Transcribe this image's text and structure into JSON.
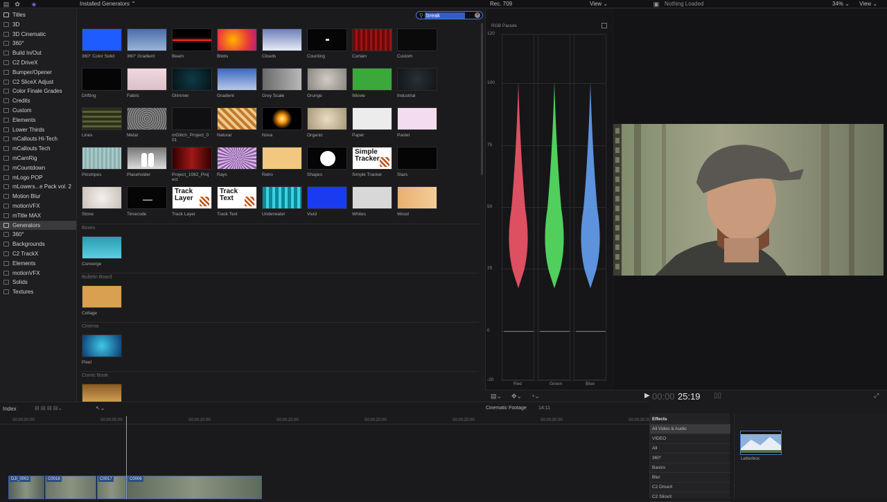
{
  "topbar": {
    "library_title": "Installed Generators",
    "library_chevron": "⌃",
    "scope_title": "Rec. 709",
    "scope_view": "View",
    "viewer_title": "Nothing Loaded",
    "zoom": "34%",
    "viewer_view": "View"
  },
  "sidebar": {
    "items": [
      {
        "label": "Titles"
      },
      {
        "label": "3D"
      },
      {
        "label": "3D Cinematic"
      },
      {
        "label": "360°"
      },
      {
        "label": "Build In/Out"
      },
      {
        "label": "C2 DriveX"
      },
      {
        "label": "Bumper/Opener"
      },
      {
        "label": "C2 SliceX Adjust"
      },
      {
        "label": "Color Finale Grades"
      },
      {
        "label": "Credits"
      },
      {
        "label": "Custom"
      },
      {
        "label": "Elements"
      },
      {
        "label": "Lower Thirds"
      },
      {
        "label": "mCallouts Hi-Tech"
      },
      {
        "label": "mCallouts Tech"
      },
      {
        "label": "mCamRig"
      },
      {
        "label": "mCountdown"
      },
      {
        "label": "mLogo POP"
      },
      {
        "label": "mLowers...e Pack vol. 2"
      },
      {
        "label": "Motion Blur"
      },
      {
        "label": "motionVFX"
      },
      {
        "label": "mTitle MAX"
      },
      {
        "label": "Generators"
      },
      {
        "label": "360°"
      },
      {
        "label": "Backgrounds"
      },
      {
        "label": "C2 TrackX"
      },
      {
        "label": "Elements"
      },
      {
        "label": "motionVFX"
      },
      {
        "label": "Solids"
      },
      {
        "label": "Textures"
      }
    ]
  },
  "search": {
    "value": "break"
  },
  "browser": {
    "tiles": [
      {
        "label": "360° Color Solid"
      },
      {
        "label": "360° Gradient"
      },
      {
        "label": "Beam"
      },
      {
        "label": "Blobs"
      },
      {
        "label": "Clouds"
      },
      {
        "label": "Counting"
      },
      {
        "label": "Curtain"
      },
      {
        "label": "Custom"
      },
      {
        "label": "Drifting"
      },
      {
        "label": "Fabric"
      },
      {
        "label": "Glimmer"
      },
      {
        "label": "Gradient"
      },
      {
        "label": "Grey Scale"
      },
      {
        "label": "Grunge"
      },
      {
        "label": "iMovie"
      },
      {
        "label": "Industrial"
      },
      {
        "label": "Lines"
      },
      {
        "label": "Metal"
      },
      {
        "label": "mGlitch_Project_0",
        "label2": "01"
      },
      {
        "label": "Natural"
      },
      {
        "label": "Nova"
      },
      {
        "label": "Organic"
      },
      {
        "label": "Paper"
      },
      {
        "label": "Pastel"
      },
      {
        "label": "Pinstripes"
      },
      {
        "label": "Placeholder"
      },
      {
        "label": "Project_1082_Proj",
        "label2": "ect"
      },
      {
        "label": "Rays"
      },
      {
        "label": "Retro"
      },
      {
        "label": "Shapes"
      },
      {
        "label": "Simple Tracker"
      },
      {
        "label": "Stars"
      },
      {
        "label": "Stone"
      },
      {
        "label": "Timecode"
      },
      {
        "label": "Track Layer"
      },
      {
        "label": "Track Text"
      },
      {
        "label": "Underwater"
      },
      {
        "label": "Vivid"
      },
      {
        "label": "Whites"
      },
      {
        "label": "Wood"
      }
    ],
    "thumb_text": {
      "simple_tracker": [
        "Simple",
        "Tracker"
      ],
      "track_layer": [
        "Track",
        "Layer"
      ],
      "track_text": [
        "Track",
        "Text"
      ]
    },
    "sections": [
      {
        "title": "Boxes",
        "item": "Converge"
      },
      {
        "title": "Bulletin Board",
        "item": "Collage"
      },
      {
        "title": "Cinema",
        "item": "Pixel"
      },
      {
        "title": "Comic Book",
        "item": ""
      }
    ]
  },
  "scope": {
    "title": "RGB Parade",
    "ticks": [
      "120",
      "100",
      "75",
      "50",
      "25",
      "0",
      "-20"
    ],
    "channels": [
      "Red",
      "Green",
      "Blue"
    ],
    "colors": {
      "red": "#ff5a6e",
      "green": "#5cf06a",
      "blue": "#6aa8ff"
    }
  },
  "playbar": {
    "timecode_dim": "00:00",
    "timecode": "25:19"
  },
  "timeline": {
    "index_label": "Index",
    "project_name": "Cinematic Footage",
    "duration": "14:11",
    "timecodes": [
      "00:00:00:00",
      "00:00:05:00",
      "00:00:10:00",
      "00:00:15:00",
      "00:00:20:00",
      "00:00:25:00",
      "00:00:30:00",
      "00:00:35:00"
    ],
    "clips": [
      {
        "name": "DJI_0002"
      },
      {
        "name": "C0016"
      },
      {
        "name": "C0017"
      },
      {
        "name": "C0006"
      }
    ]
  },
  "effects": {
    "header": "Effects",
    "items": [
      {
        "label": "All Video & Audio"
      },
      {
        "label": "VIDEO"
      },
      {
        "label": "All"
      },
      {
        "label": "360°"
      },
      {
        "label": "Basics"
      },
      {
        "label": "Blur"
      },
      {
        "label": "C2 DriveX"
      },
      {
        "label": "C2 SliceX"
      }
    ],
    "preview_label": "Letterbox"
  }
}
